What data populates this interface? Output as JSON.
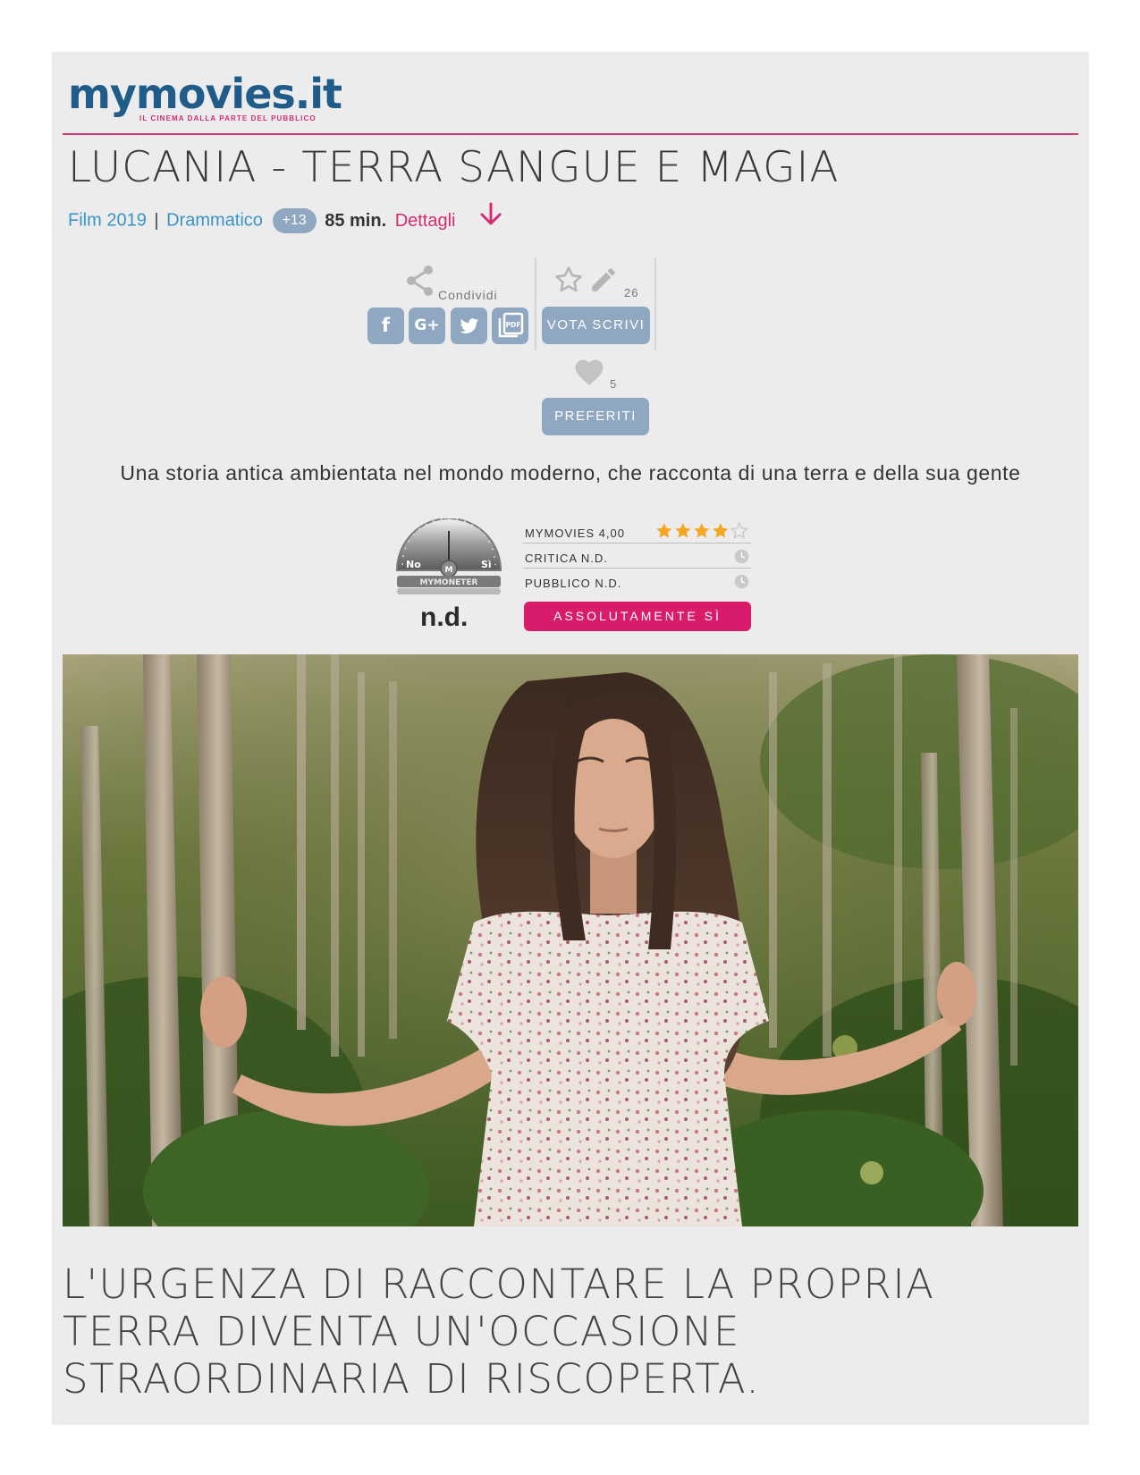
{
  "brand": {
    "logo_text": "mymovies.it",
    "tagline": "IL CINEMA DALLA PARTE DEL PUBBLICO",
    "accent_color": "#d42c72",
    "brand_blue": "#1f5c8a"
  },
  "film": {
    "title": "LUCANIA - TERRA SANGUE E MAGIA",
    "type_year": "Film 2019",
    "separator": "|",
    "genre": "Drammatico",
    "age_rating": "+13",
    "duration": "85 min.",
    "details_link": "Dettagli"
  },
  "share": {
    "label": "Condividi",
    "buttons": [
      {
        "name": "facebook",
        "icon": "facebook-icon",
        "glyph": "f"
      },
      {
        "name": "google-plus",
        "icon": "google-plus-icon",
        "glyph": "G+"
      },
      {
        "name": "twitter",
        "icon": "twitter-icon",
        "glyph": "🐦"
      },
      {
        "name": "pdf",
        "icon": "pdf-icon",
        "glyph": "PDF"
      }
    ]
  },
  "vote": {
    "count": "26",
    "button_label": "VOTA SCRIVI"
  },
  "favorites": {
    "count": "5",
    "button_label": "PREFERITI"
  },
  "tagline": "Una storia antica ambientata nel mondo moderno, che racconta di una terra e della sua gente",
  "mymoneter": {
    "label_no": "No",
    "label_si": "Sì",
    "brand": "MYMONETER",
    "value": "n.d."
  },
  "ratings": {
    "mymovies_label": "MYMOVIES 4,00",
    "mymovies_stars": 4,
    "mymovies_stars_max": 5,
    "critica_label": "CRITICA N.D.",
    "pubblico_label": "PUBBLICO N.D.",
    "verdict_button": "ASSOLUTAMENTE SÌ"
  },
  "headline": "L'URGENZA DI RACCONTARE LA PROPRIA TERRA DIVENTA UN'OCCASIONE STRAORDINARIA DI RISCOPERTA."
}
